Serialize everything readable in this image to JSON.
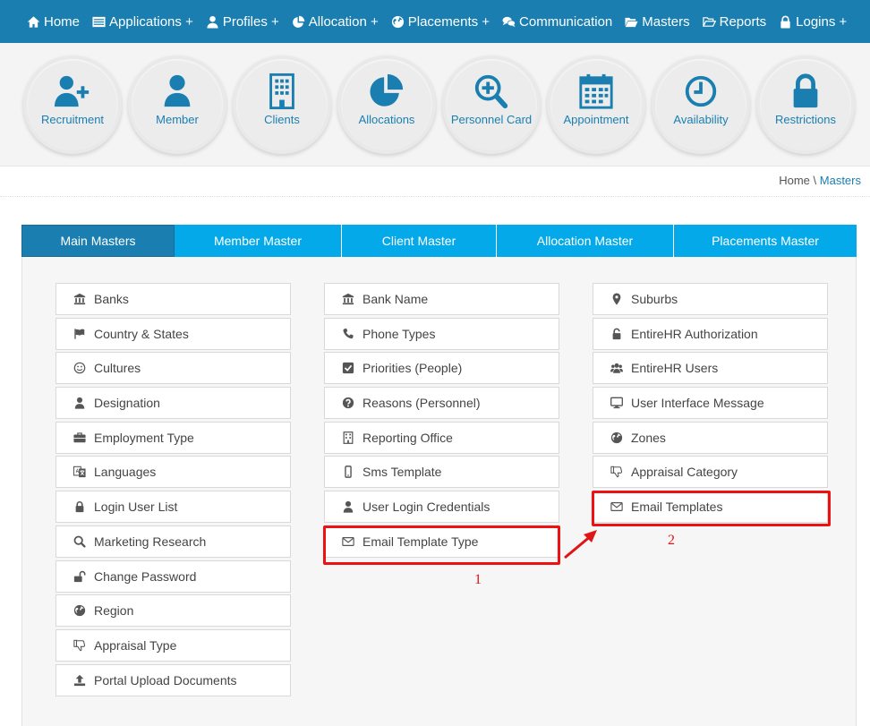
{
  "nav": {
    "items": [
      {
        "label": "Home",
        "icon": "home-icon"
      },
      {
        "label": "Applications +",
        "icon": "list-icon"
      },
      {
        "label": "Profiles +",
        "icon": "user-icon"
      },
      {
        "label": "Allocation +",
        "icon": "pie-chart-icon"
      },
      {
        "label": "Placements +",
        "icon": "globe-icon"
      },
      {
        "label": "Communication",
        "icon": "comments-icon"
      },
      {
        "label": "Masters",
        "icon": "folder-open-icon"
      },
      {
        "label": "Reports",
        "icon": "folder-open-outline-icon"
      },
      {
        "label": "Logins +",
        "icon": "lock-icon"
      }
    ]
  },
  "shortcuts": [
    {
      "label": "Recruitment",
      "icon": "user-plus-icon"
    },
    {
      "label": "Member",
      "icon": "user-icon"
    },
    {
      "label": "Clients",
      "icon": "building-icon"
    },
    {
      "label": "Allocations",
      "icon": "pie-chart-icon"
    },
    {
      "label": "Personnel Card",
      "icon": "search-plus-icon"
    },
    {
      "label": "Appointment",
      "icon": "calendar-icon"
    },
    {
      "label": "Availability",
      "icon": "clock-icon"
    },
    {
      "label": "Restrictions",
      "icon": "lock-icon"
    }
  ],
  "breadcrumb": {
    "home": "Home",
    "separator": " \\ ",
    "current": "Masters"
  },
  "tabs": [
    {
      "label": "Main Masters",
      "active": true
    },
    {
      "label": "Member Master",
      "active": false
    },
    {
      "label": "Client Master",
      "active": false
    },
    {
      "label": "Allocation Master",
      "active": false
    },
    {
      "label": "Placements Master",
      "active": false
    }
  ],
  "columns": [
    [
      {
        "label": "Banks",
        "icon": "bank-icon"
      },
      {
        "label": "Country & States",
        "icon": "flag-icon"
      },
      {
        "label": "Cultures",
        "icon": "smile-icon"
      },
      {
        "label": "Designation",
        "icon": "user-icon"
      },
      {
        "label": "Employment Type",
        "icon": "briefcase-icon"
      },
      {
        "label": "Languages",
        "icon": "language-icon"
      },
      {
        "label": "Login User List",
        "icon": "lock-icon"
      },
      {
        "label": "Marketing Research",
        "icon": "search-icon"
      },
      {
        "label": "Change Password",
        "icon": "unlock-icon"
      },
      {
        "label": "Region",
        "icon": "globe-icon"
      },
      {
        "label": "Appraisal Type",
        "icon": "thumbs-down-icon"
      },
      {
        "label": "Portal Upload Documents",
        "icon": "upload-icon"
      }
    ],
    [
      {
        "label": "Bank Name",
        "icon": "bank-icon"
      },
      {
        "label": "Phone Types",
        "icon": "phone-icon"
      },
      {
        "label": "Priorities (People)",
        "icon": "check-square-icon"
      },
      {
        "label": "Reasons (Personnel)",
        "icon": "question-circle-icon"
      },
      {
        "label": "Reporting Office",
        "icon": "building-icon"
      },
      {
        "label": "Sms Template",
        "icon": "mobile-icon"
      },
      {
        "label": "User Login Credentials",
        "icon": "user-icon"
      },
      {
        "label": "Email Template Type",
        "icon": "envelope-icon"
      }
    ],
    [
      {
        "label": "Suburbs",
        "icon": "map-marker-icon"
      },
      {
        "label": "EntireHR Authorization",
        "icon": "unlock-icon"
      },
      {
        "label": "EntireHR Users",
        "icon": "users-icon"
      },
      {
        "label": "User Interface Message",
        "icon": "desktop-icon"
      },
      {
        "label": "Zones",
        "icon": "globe-icon"
      },
      {
        "label": "Appraisal Category",
        "icon": "thumbs-down-icon"
      },
      {
        "label": "Email Templates",
        "icon": "envelope-icon"
      }
    ]
  ],
  "annotations": {
    "step1": "1",
    "step2": "2"
  },
  "colors": {
    "nav": "#1a7fb0",
    "tab": "#03a9e8",
    "tab_active": "#1a7fb0",
    "highlight": "#ee1111"
  }
}
